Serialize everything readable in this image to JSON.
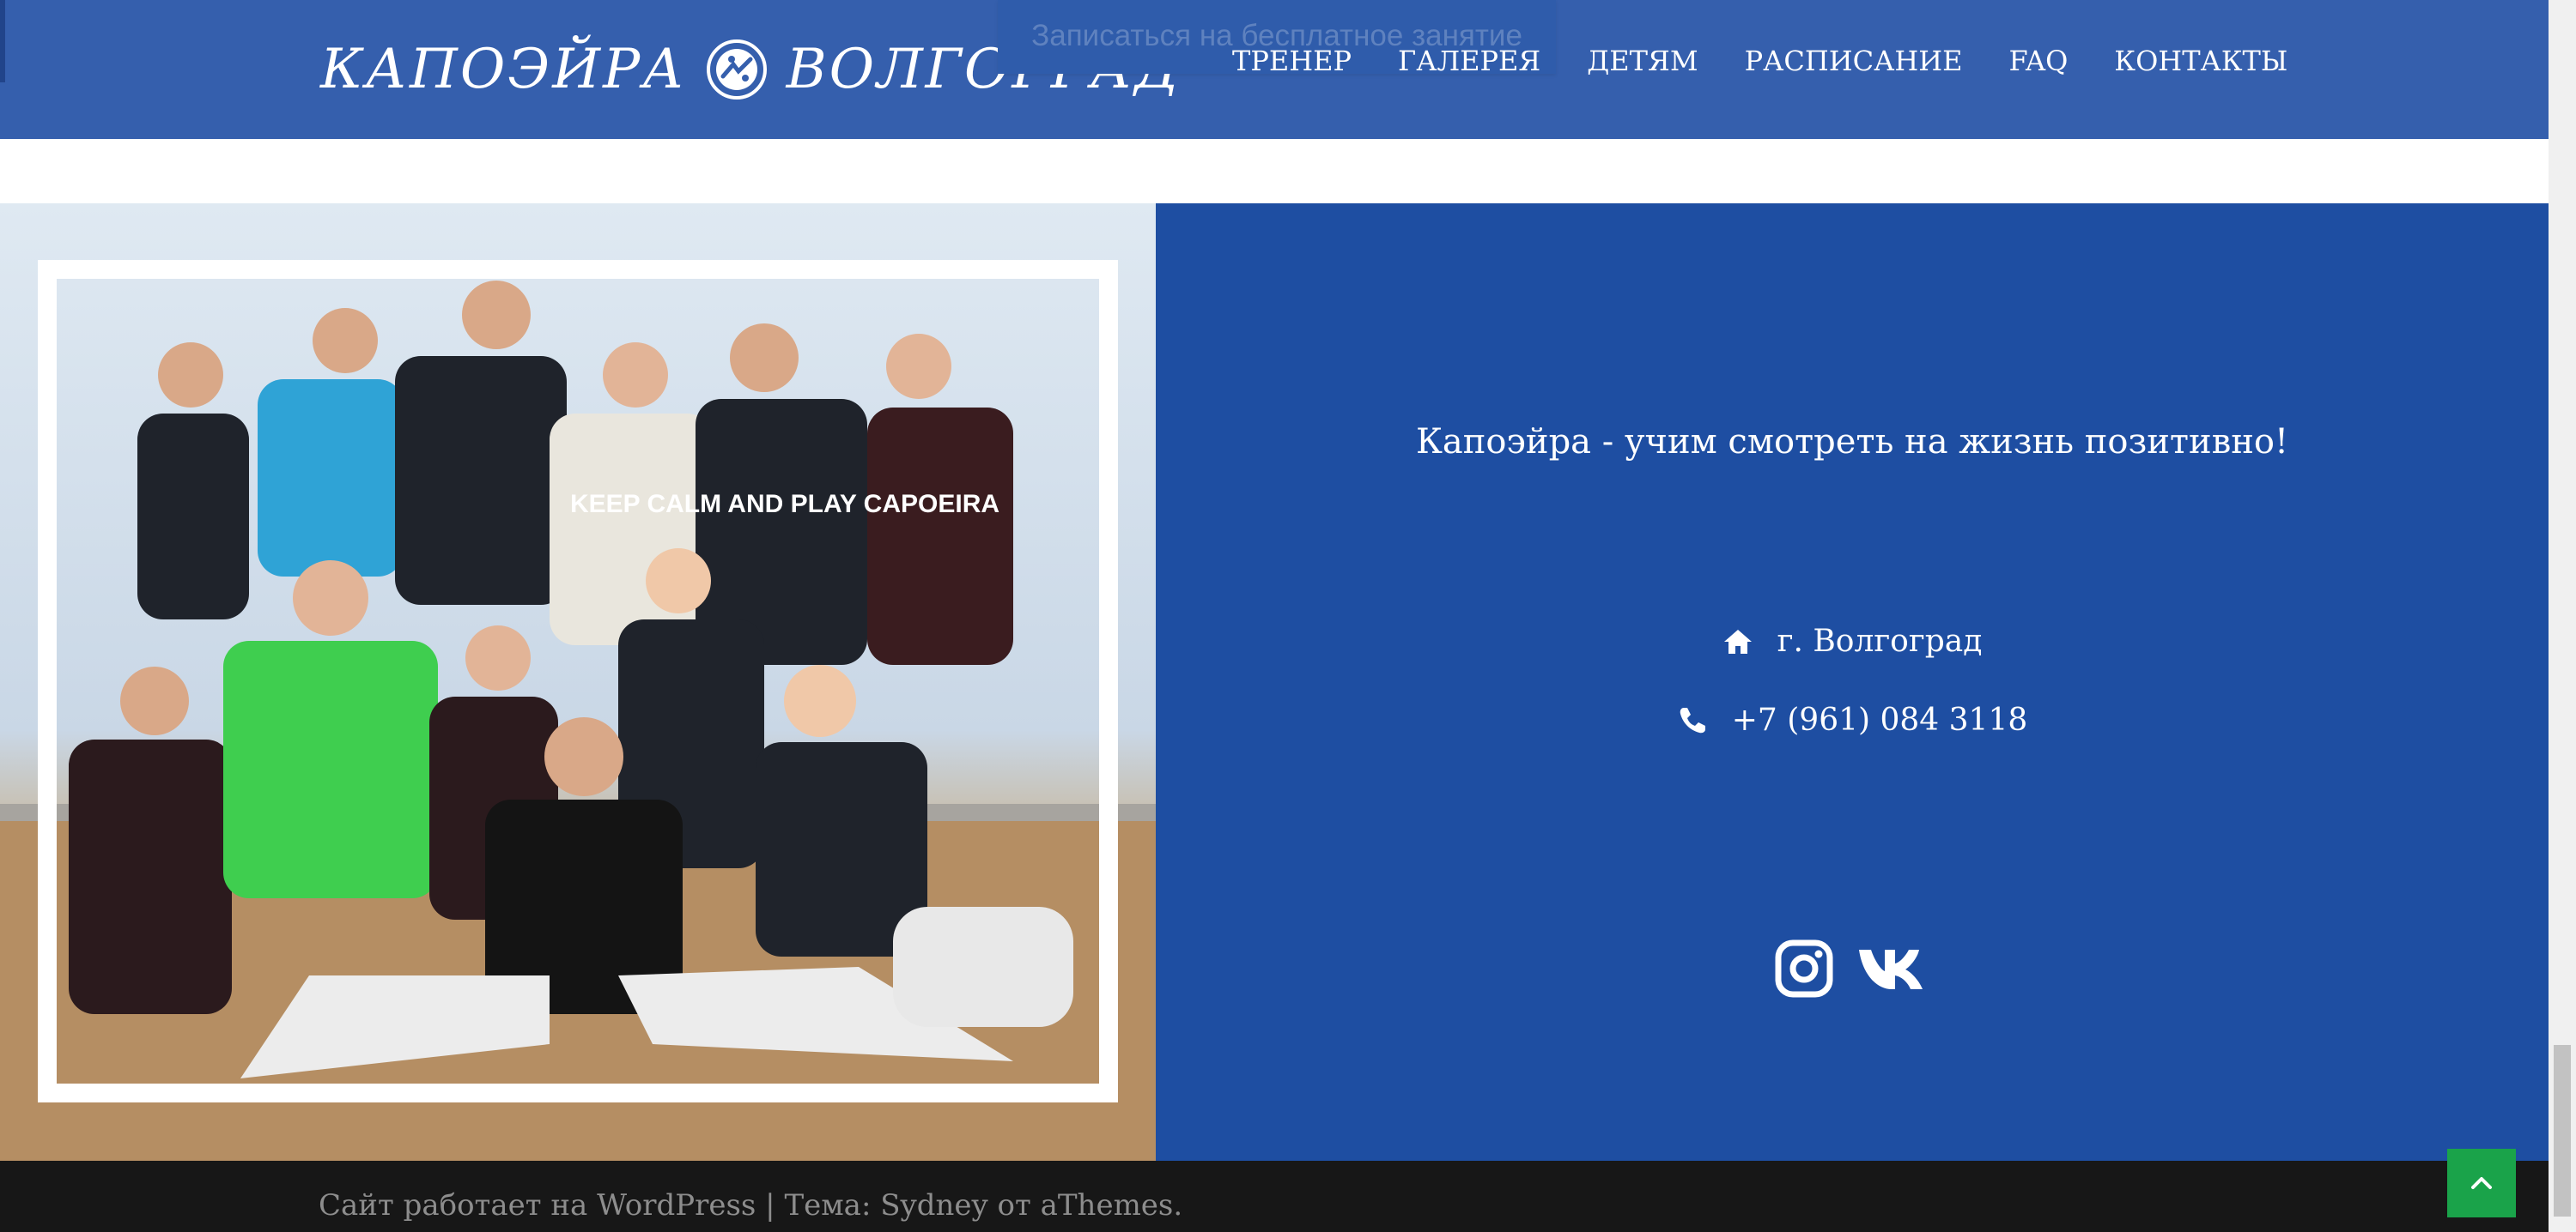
{
  "header": {
    "logo_left": "КАПОЭЙРА",
    "logo_right": "ВОЛГОГРАД",
    "free_lesson_button": "Записаться на бесплатное занятие",
    "nav": [
      "ТРЕНЕР",
      "ГАЛЕРЕЯ",
      "ДЕТЯМ",
      "РАСПИСАНИЕ",
      "FAQ",
      "КОНТАКТЫ"
    ]
  },
  "hero": {
    "tagline": "Капоэйра - учим смотреть на жизнь позитивно!",
    "address_icon": "home-icon",
    "address": "г. Волгоград",
    "phone_icon": "phone-icon",
    "phone": "+7 (961) 084 3118",
    "socials": [
      "instagram-icon",
      "vk-icon"
    ],
    "photo_shirt_text": "KEEP CALM AND PLAY CAPOEIRA"
  },
  "footer": {
    "text": "Сайт работает на WordPress | Тема: Sydney от aThemes.",
    "to_top_icon": "chevron-up-icon"
  },
  "colors": {
    "header_bg": "#355fad",
    "info_bg": "#1e4ea2",
    "footer_bg": "#171717",
    "to_top_bg": "#1aa34a"
  }
}
